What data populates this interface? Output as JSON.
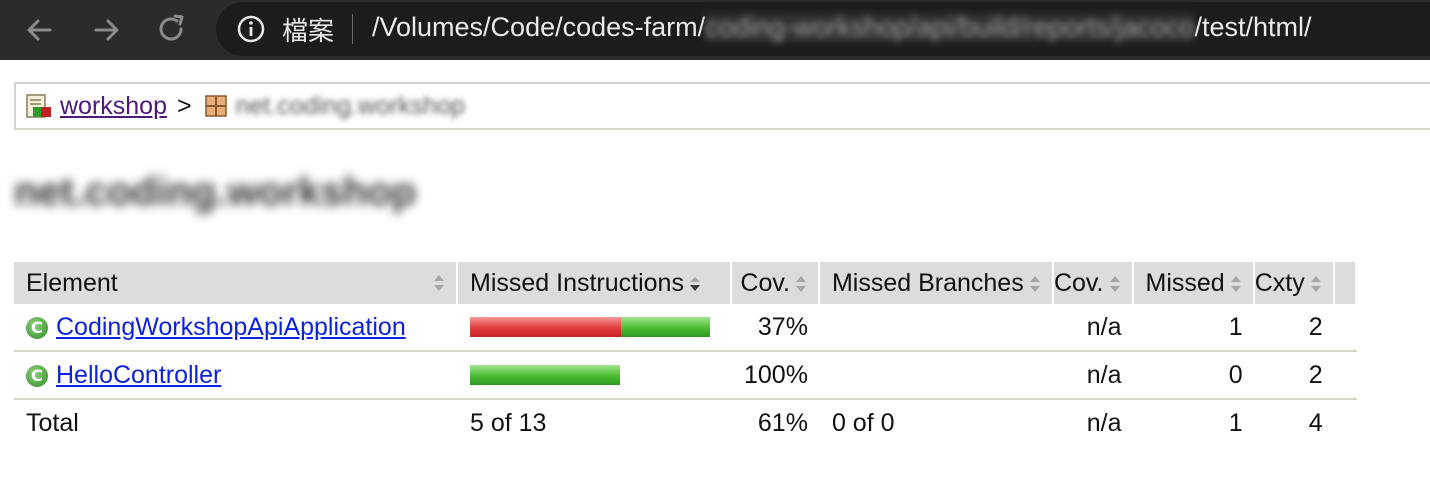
{
  "browser": {
    "scheme_label": "檔案",
    "url_prefix": "/Volumes/Code/codes-farm/",
    "url_hidden": "coding-workshop/api/build/reports/jacoco",
    "url_suffix": "/test/html/"
  },
  "breadcrumb": {
    "root_label": "workshop",
    "separator": ">",
    "package_label": "net.coding.workshop"
  },
  "page": {
    "title": "net.coding.workshop"
  },
  "table": {
    "headers": {
      "element": "Element",
      "missed_instructions": "Missed Instructions",
      "cov_instructions": "Cov.",
      "missed_branches": "Missed Branches",
      "cov_branches": "Cov.",
      "missed_cxty": "Missed",
      "cxty": "Cxty"
    },
    "rows": [
      {
        "element": "CodingWorkshopApiApplication",
        "missed_fraction": 0.63,
        "covered_fraction": 0.37,
        "cov": "37%",
        "branches": "",
        "branch_cov": "n/a",
        "missed": "1",
        "cxty": "2"
      },
      {
        "element": "HelloController",
        "missed_fraction": 0.0,
        "covered_fraction": 1.0,
        "cov": "100%",
        "branches": "",
        "branch_cov": "n/a",
        "missed": "0",
        "cxty": "2"
      }
    ],
    "total": {
      "label": "Total",
      "missed_instructions": "5 of 13",
      "cov": "61%",
      "missed_branches": "0 of 0",
      "branch_cov": "n/a",
      "missed": "1",
      "cxty": "4"
    }
  },
  "colors": {
    "chrome_bg": "#2b2b2e",
    "bar_missed": "#e33b3b",
    "bar_covered": "#4cbb34",
    "link": "#0d22e0",
    "visited_link": "#4b1a7c"
  },
  "icons": {
    "back": "arrow-left-icon",
    "forward": "arrow-right-icon",
    "reload": "reload-icon",
    "info": "info-circle-icon",
    "report": "report-icon",
    "package": "package-icon",
    "class": "class-icon"
  }
}
